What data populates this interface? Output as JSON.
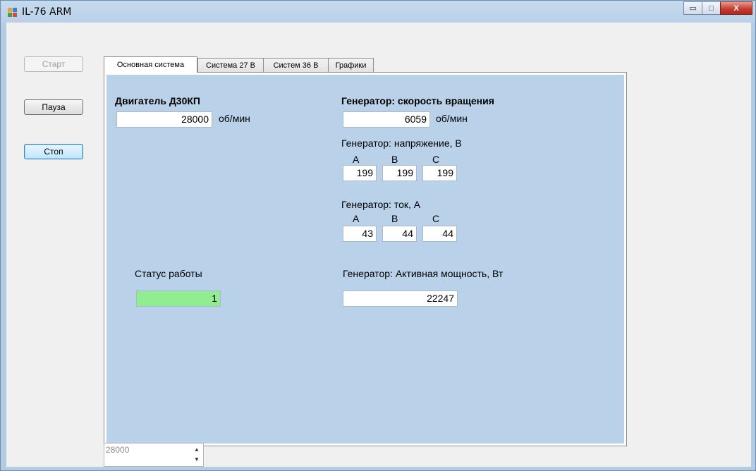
{
  "window": {
    "title": "IL-76 ARM",
    "controls": {
      "minimize": "▭",
      "maximize": "□",
      "close": "X"
    }
  },
  "sidebar": {
    "start_label": "Старт",
    "pause_label": "Пауза",
    "stop_label": "Стоп"
  },
  "tabs": [
    {
      "label": "Основная система"
    },
    {
      "label": "Система 27 В"
    },
    {
      "label": "Систем 36 В"
    },
    {
      "label": "Графики"
    }
  ],
  "main": {
    "engine_title": "Двигатель Д30КП",
    "engine_rpm": "28000",
    "engine_unit": "об/мин",
    "gen_speed_title": "Генератор: скорость вращения",
    "gen_speed": "6059",
    "gen_speed_unit": "об/мин",
    "voltage_title": "Генератор: напряжение, В",
    "voltage_phases": [
      "A",
      "B",
      "C"
    ],
    "voltage_values": [
      "199",
      "199",
      "199"
    ],
    "current_title": "Генератор: ток, А",
    "current_phases": [
      "A",
      "B",
      "C"
    ],
    "current_values": [
      "43",
      "44",
      "44"
    ],
    "status_title": "Статус работы",
    "status_value": "1",
    "power_title": "Генератор: Активная мощность, Вт",
    "power_value": "22247"
  },
  "footer": {
    "numeric_value": "28000",
    "spin_up": "▲",
    "spin_down": "▼"
  },
  "colors": {
    "tab_background": "#b9d2ea",
    "status_ok": "#90ee90"
  }
}
